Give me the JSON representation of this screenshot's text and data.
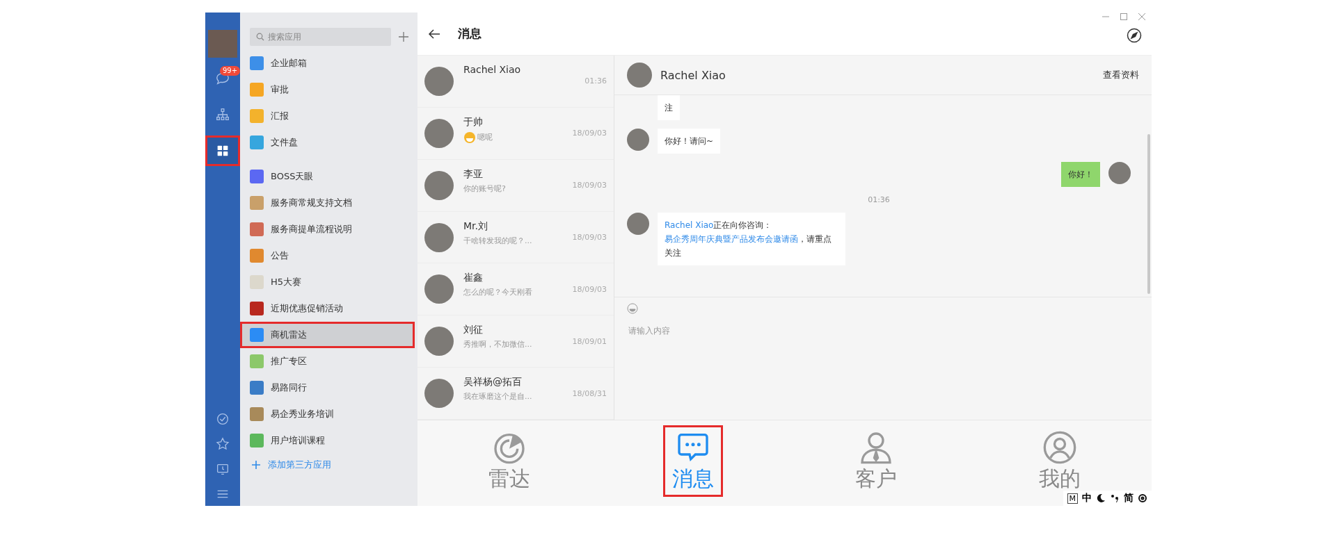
{
  "rail": {
    "items": [
      {
        "kind": "chat",
        "badge": "99+",
        "selected": false,
        "highlighted": false
      },
      {
        "kind": "org",
        "selected": false,
        "highlighted": false
      },
      {
        "kind": "apps",
        "selected": true,
        "highlighted": true
      }
    ],
    "bottom_items": [
      {
        "kind": "check"
      },
      {
        "kind": "star"
      },
      {
        "kind": "screen"
      },
      {
        "kind": "menu"
      }
    ]
  },
  "app_panel": {
    "search": {
      "placeholder": "搜索应用"
    },
    "groups": [
      [
        {
          "label": "企业邮箱",
          "color": "#3d8fe8",
          "selected": false,
          "highlighted": false
        },
        {
          "label": "审批",
          "color": "#f5a623",
          "selected": false,
          "highlighted": false
        },
        {
          "label": "汇报",
          "color": "#f3b22c",
          "selected": false,
          "highlighted": false
        },
        {
          "label": "文件盘",
          "color": "#36a6de",
          "selected": false,
          "highlighted": false
        }
      ],
      [
        {
          "label": "BOSS天眼",
          "color": "#5b68f2",
          "selected": false,
          "highlighted": false
        },
        {
          "label": "服务商常规支持文档",
          "color": "#c9a06a",
          "selected": false,
          "highlighted": false
        },
        {
          "label": "服务商提单流程说明",
          "color": "#d06a55",
          "selected": false,
          "highlighted": false
        },
        {
          "label": "公告",
          "color": "#e0892f",
          "selected": false,
          "highlighted": false
        },
        {
          "label": "H5大赛",
          "color": "#dcd8cc",
          "selected": false,
          "highlighted": false
        },
        {
          "label": "近期优惠促销活动",
          "color": "#b8281e",
          "selected": false,
          "highlighted": false
        },
        {
          "label": "商机雷达",
          "color": "#2b8cf5",
          "selected": true,
          "highlighted": true
        },
        {
          "label": "推广专区",
          "color": "#8cc86a",
          "selected": false,
          "highlighted": false
        },
        {
          "label": "易路同行",
          "color": "#3a7cc6",
          "selected": false,
          "highlighted": false
        },
        {
          "label": "易企秀业务培训",
          "color": "#a88a5a",
          "selected": false,
          "highlighted": false
        },
        {
          "label": "用户培训课程",
          "color": "#5cb85c",
          "selected": false,
          "highlighted": false
        }
      ]
    ],
    "add_link": "添加第三方应用"
  },
  "header": {
    "title": "消息"
  },
  "conversations": [
    {
      "name": "Rachel Xiao",
      "time": "01:36",
      "emoji": false
    },
    {
      "name": "于帅",
      "preview": "嗯呢",
      "time": "18/09/03",
      "emoji": true
    },
    {
      "name": "李亚",
      "preview": "你的账号呢?",
      "time": "18/09/03",
      "emoji": false
    },
    {
      "name": "Mr.刘",
      "preview": "干啥转发我的呢？...",
      "time": "18/09/03",
      "emoji": false
    },
    {
      "name": "崔鑫",
      "preview": "怎么的呢？今天刚看",
      "time": "18/09/03",
      "emoji": false
    },
    {
      "name": "刘征",
      "preview": "秀推啊，不加微信...",
      "time": "18/09/01",
      "emoji": false
    },
    {
      "name": "吴祥杨@拓百",
      "preview": "我在琢磨这个是自...",
      "time": "18/08/31",
      "emoji": false
    }
  ],
  "chat": {
    "contact": "Rachel Xiao",
    "profile_link": "查看资料",
    "messages": [
      {
        "kind": "incoming",
        "avatar": false,
        "text": "注"
      },
      {
        "kind": "incoming",
        "avatar": true,
        "text": "你好！请问~"
      },
      {
        "kind": "outgoing",
        "avatar": true,
        "text": "你好！"
      },
      {
        "kind": "time",
        "text": "01:36"
      },
      {
        "kind": "incoming",
        "avatar": true,
        "parts": [
          {
            "text": "Rachel Xiao",
            "link": true
          },
          {
            "text": "正在向你咨询：",
            "link": false
          },
          {
            "text": "易企秀周年庆典暨产品发布会邀请函",
            "link": true
          },
          {
            "text": "，请重点关注",
            "link": false
          }
        ]
      }
    ],
    "input": {
      "placeholder": "请输入内容"
    }
  },
  "tabs": [
    {
      "label": "雷达",
      "kind": "radar",
      "selected": false,
      "highlighted": false
    },
    {
      "label": "消息",
      "kind": "message",
      "selected": true,
      "highlighted": true
    },
    {
      "label": "客户",
      "kind": "customer",
      "selected": false,
      "highlighted": false
    },
    {
      "label": "我的",
      "kind": "profile",
      "selected": false,
      "highlighted": false
    }
  ],
  "ime": {
    "mode": "M",
    "language": "中",
    "script": "简"
  }
}
